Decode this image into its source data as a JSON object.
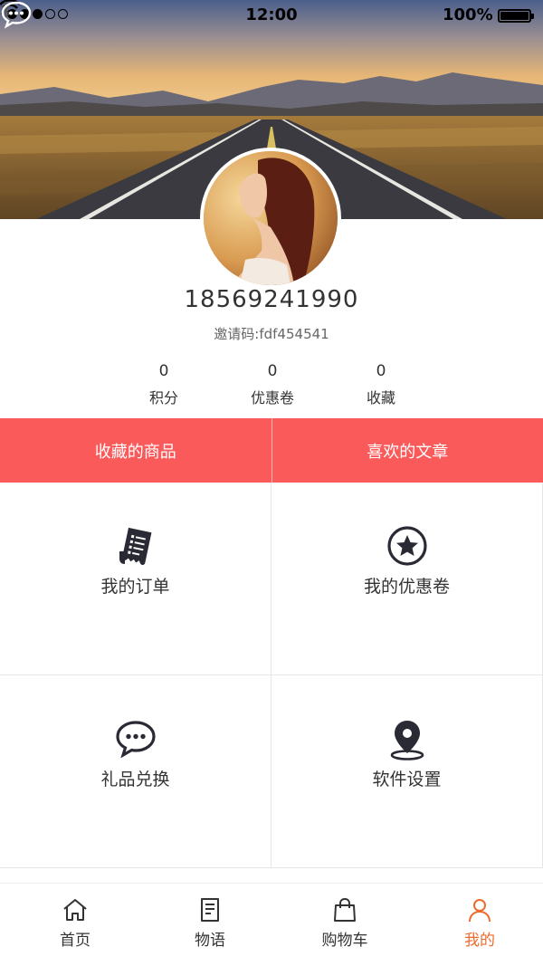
{
  "status_bar": {
    "time": "12:00",
    "battery": "100%"
  },
  "profile": {
    "phone": "18569241990",
    "invite_code": "邀请码:fdf454541"
  },
  "stats": [
    {
      "value": "0",
      "label": "积分"
    },
    {
      "value": "0",
      "label": "优惠卷"
    },
    {
      "value": "0",
      "label": "收藏"
    }
  ],
  "tabs": [
    {
      "label": "收藏的商品"
    },
    {
      "label": "喜欢的文章"
    }
  ],
  "menu": [
    {
      "label": "我的订单",
      "icon": "receipt-icon"
    },
    {
      "label": "我的优惠卷",
      "icon": "star-circle-icon"
    },
    {
      "label": "礼品兑换",
      "icon": "chat-bubble-icon"
    },
    {
      "label": "软件设置",
      "icon": "location-pin-icon"
    }
  ],
  "tabbar": [
    {
      "label": "首页",
      "icon": "home-icon",
      "active": false
    },
    {
      "label": "物语",
      "icon": "document-icon",
      "active": false
    },
    {
      "label": "购物车",
      "icon": "shopping-bag-icon",
      "active": false
    },
    {
      "label": "我的",
      "icon": "user-icon",
      "active": true
    }
  ],
  "colors": {
    "accent": "#fa5a5a",
    "tab_active": "#ee6b2d",
    "icon_dark": "#2a2a35"
  }
}
